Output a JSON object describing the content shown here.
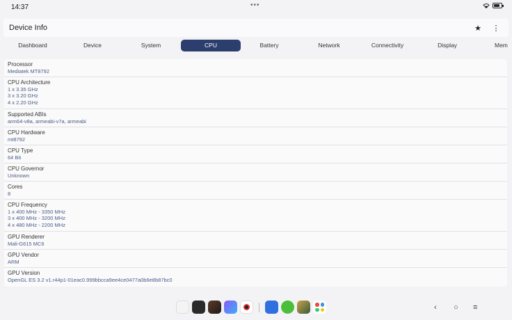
{
  "status_bar": {
    "time": "14:37",
    "dots": "•••",
    "wifi_icon": "wifi-icon",
    "battery_icon": "battery-icon",
    "battery_level": 0.8
  },
  "app_bar": {
    "title": "Device Info",
    "star_icon": "★",
    "more_icon": "⋮"
  },
  "tabs": [
    {
      "label": "Dashboard"
    },
    {
      "label": "Device"
    },
    {
      "label": "System"
    },
    {
      "label": "CPU",
      "active": true
    },
    {
      "label": "Battery"
    },
    {
      "label": "Network"
    },
    {
      "label": "Connectivity"
    },
    {
      "label": "Display"
    },
    {
      "label": "Mem"
    }
  ],
  "rows": [
    {
      "label": "Processor",
      "values": [
        "Mediatek MT8792"
      ]
    },
    {
      "label": "CPU Architecture",
      "values": [
        "1 x 3.35 GHz",
        "3 x 3.20 GHz",
        "4 x 2.20 GHz"
      ]
    },
    {
      "label": "Supported ABIs",
      "values": [
        "arm64-v8a, armeabi-v7a, armeabi"
      ]
    },
    {
      "label": "CPU Hardware",
      "values": [
        "mt8792"
      ]
    },
    {
      "label": "CPU Type",
      "values": [
        "64 Bit"
      ]
    },
    {
      "label": "CPU Governor",
      "values": [
        "Unknown"
      ]
    },
    {
      "label": "Cores",
      "values": [
        "8"
      ]
    },
    {
      "label": "CPU Frequency",
      "values": [
        "1 x 400 MHz - 3350 MHz",
        "3 x 400 MHz - 3200 MHz",
        "4 x 480 MHz - 2200 MHz"
      ]
    },
    {
      "label": "GPU Renderer",
      "values": [
        "Mali-G615 MC6"
      ]
    },
    {
      "label": "GPU Vendor",
      "values": [
        "ARM"
      ]
    },
    {
      "label": "GPU Version",
      "values": [
        "OpenGL ES 3.2 v1.r44p1-01eac0.999bbcca9ee4ce0477a0b6e8b87bc0"
      ]
    }
  ],
  "nav_bar": {
    "back_icon": "‹",
    "home_icon": "○",
    "recents_icon": "≡"
  },
  "colors": {
    "accent": "#2c3e6e",
    "value_text": "#4a5a85"
  }
}
